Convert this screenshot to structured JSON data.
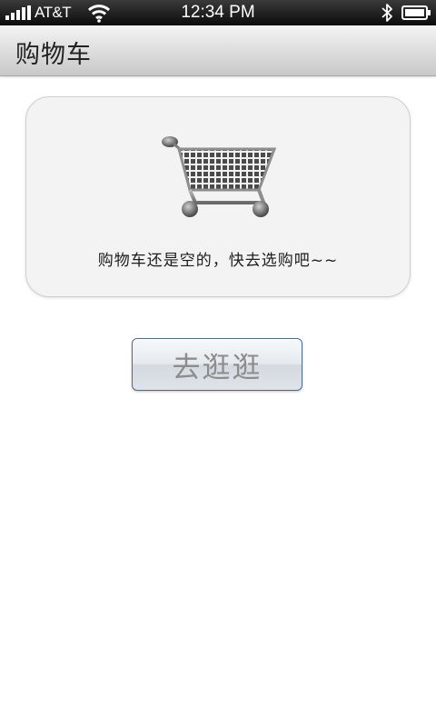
{
  "status_bar": {
    "carrier": "AT&T",
    "time": "12:34 PM",
    "icons": [
      "signal-icon",
      "wifi-icon",
      "bluetooth-icon",
      "battery-icon"
    ]
  },
  "header": {
    "title": "购物车"
  },
  "empty_cart": {
    "icon": "shopping-cart-icon",
    "message": "购物车还是空的，快去选购吧~~"
  },
  "actions": {
    "go_shopping_label": "去逛逛"
  },
  "colors": {
    "status_bar_bg": "#1a1a1a",
    "title_bar_bg": "#d8d8d8",
    "panel_bg": "#f3f3f3",
    "button_border": "#4f6d91",
    "button_text": "#8c8c8c"
  }
}
